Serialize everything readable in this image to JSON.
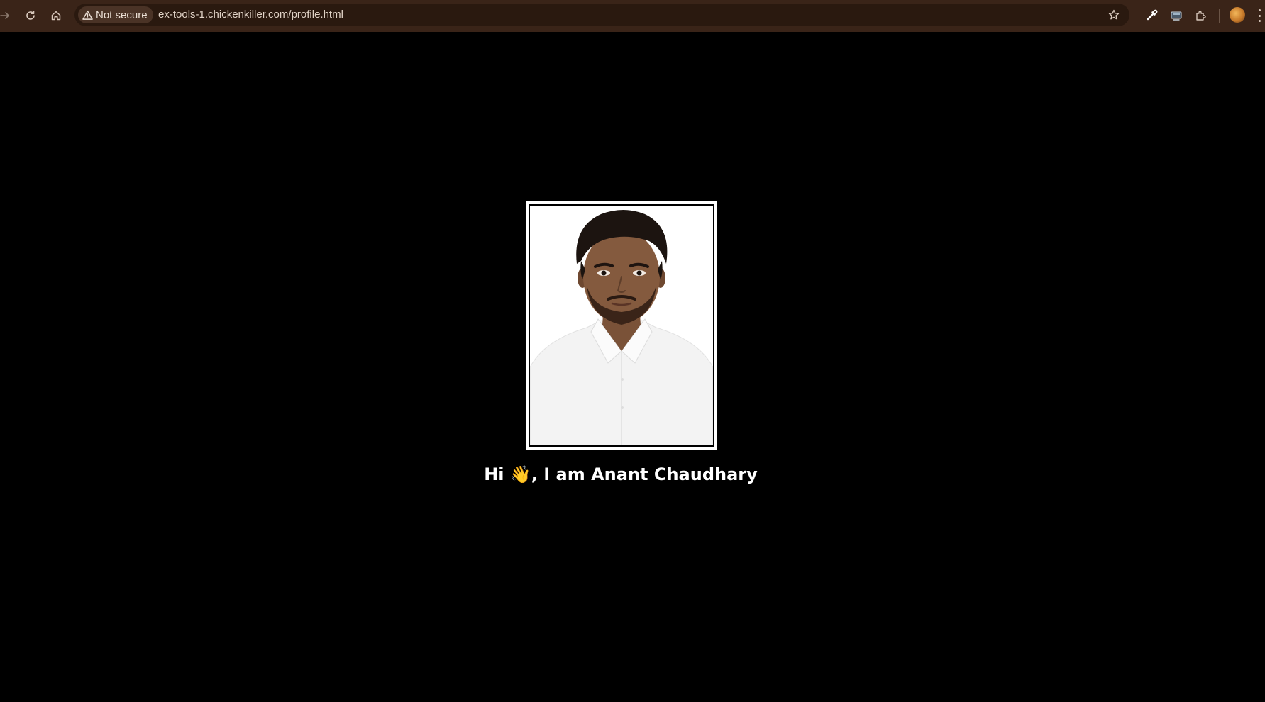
{
  "browser": {
    "security_label": "Not secure",
    "url": "ex-tools-1.chickenkiller.com/profile.html",
    "toolbar_color": "#3a2418",
    "omnibox_color": "#2a190f"
  },
  "page": {
    "background": "#000000",
    "photo_alt": "Profile photo of Anant Chaudhary",
    "greeting": "Hi 👋, I am Anant Chaudhary"
  }
}
